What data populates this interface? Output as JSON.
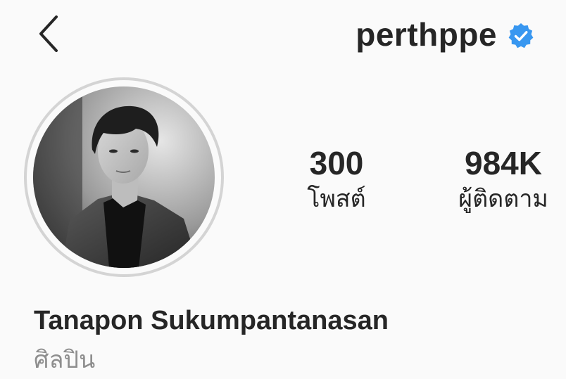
{
  "header": {
    "back_icon": "chevron-left-icon",
    "username": "perthppe",
    "verified_icon": "verified-badge-icon",
    "verified_color": "#3897f0"
  },
  "profile": {
    "avatar": "profile-photo",
    "stats": {
      "posts": {
        "count": "300",
        "label": "โพสต์"
      },
      "followers": {
        "count": "984K",
        "label": "ผู้ติดตาม"
      }
    },
    "full_name": "Tanapon Sukumpantanasan",
    "category": "ศิลปิน"
  },
  "colors": {
    "background": "#fafafa",
    "text": "#262626",
    "secondary_text": "#8e8e8e",
    "avatar_ring": "#d4d4d4"
  }
}
